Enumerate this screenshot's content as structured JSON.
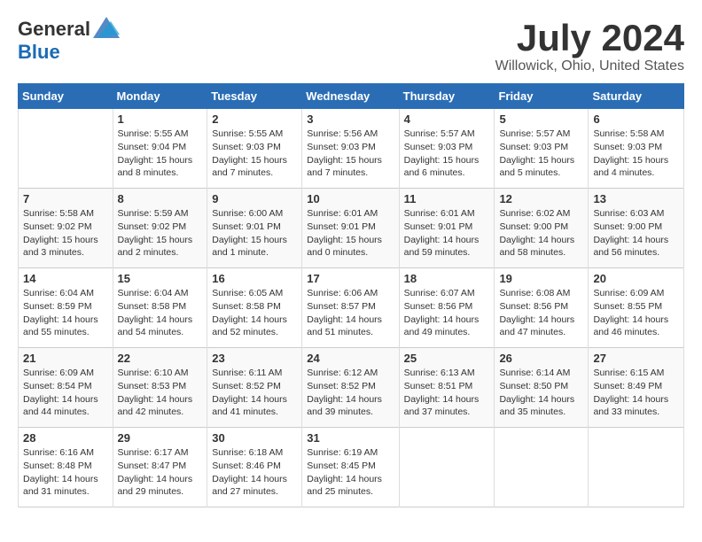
{
  "header": {
    "logo_general": "General",
    "logo_blue": "Blue",
    "month_title": "July 2024",
    "location": "Willowick, Ohio, United States"
  },
  "calendar": {
    "days_of_week": [
      "Sunday",
      "Monday",
      "Tuesday",
      "Wednesday",
      "Thursday",
      "Friday",
      "Saturday"
    ],
    "weeks": [
      [
        {
          "day": "",
          "sunrise": "",
          "sunset": "",
          "daylight": ""
        },
        {
          "day": "1",
          "sunrise": "Sunrise: 5:55 AM",
          "sunset": "Sunset: 9:04 PM",
          "daylight": "Daylight: 15 hours and 8 minutes."
        },
        {
          "day": "2",
          "sunrise": "Sunrise: 5:55 AM",
          "sunset": "Sunset: 9:03 PM",
          "daylight": "Daylight: 15 hours and 7 minutes."
        },
        {
          "day": "3",
          "sunrise": "Sunrise: 5:56 AM",
          "sunset": "Sunset: 9:03 PM",
          "daylight": "Daylight: 15 hours and 7 minutes."
        },
        {
          "day": "4",
          "sunrise": "Sunrise: 5:57 AM",
          "sunset": "Sunset: 9:03 PM",
          "daylight": "Daylight: 15 hours and 6 minutes."
        },
        {
          "day": "5",
          "sunrise": "Sunrise: 5:57 AM",
          "sunset": "Sunset: 9:03 PM",
          "daylight": "Daylight: 15 hours and 5 minutes."
        },
        {
          "day": "6",
          "sunrise": "Sunrise: 5:58 AM",
          "sunset": "Sunset: 9:03 PM",
          "daylight": "Daylight: 15 hours and 4 minutes."
        }
      ],
      [
        {
          "day": "7",
          "sunrise": "Sunrise: 5:58 AM",
          "sunset": "Sunset: 9:02 PM",
          "daylight": "Daylight: 15 hours and 3 minutes."
        },
        {
          "day": "8",
          "sunrise": "Sunrise: 5:59 AM",
          "sunset": "Sunset: 9:02 PM",
          "daylight": "Daylight: 15 hours and 2 minutes."
        },
        {
          "day": "9",
          "sunrise": "Sunrise: 6:00 AM",
          "sunset": "Sunset: 9:01 PM",
          "daylight": "Daylight: 15 hours and 1 minute."
        },
        {
          "day": "10",
          "sunrise": "Sunrise: 6:01 AM",
          "sunset": "Sunset: 9:01 PM",
          "daylight": "Daylight: 15 hours and 0 minutes."
        },
        {
          "day": "11",
          "sunrise": "Sunrise: 6:01 AM",
          "sunset": "Sunset: 9:01 PM",
          "daylight": "Daylight: 14 hours and 59 minutes."
        },
        {
          "day": "12",
          "sunrise": "Sunrise: 6:02 AM",
          "sunset": "Sunset: 9:00 PM",
          "daylight": "Daylight: 14 hours and 58 minutes."
        },
        {
          "day": "13",
          "sunrise": "Sunrise: 6:03 AM",
          "sunset": "Sunset: 9:00 PM",
          "daylight": "Daylight: 14 hours and 56 minutes."
        }
      ],
      [
        {
          "day": "14",
          "sunrise": "Sunrise: 6:04 AM",
          "sunset": "Sunset: 8:59 PM",
          "daylight": "Daylight: 14 hours and 55 minutes."
        },
        {
          "day": "15",
          "sunrise": "Sunrise: 6:04 AM",
          "sunset": "Sunset: 8:58 PM",
          "daylight": "Daylight: 14 hours and 54 minutes."
        },
        {
          "day": "16",
          "sunrise": "Sunrise: 6:05 AM",
          "sunset": "Sunset: 8:58 PM",
          "daylight": "Daylight: 14 hours and 52 minutes."
        },
        {
          "day": "17",
          "sunrise": "Sunrise: 6:06 AM",
          "sunset": "Sunset: 8:57 PM",
          "daylight": "Daylight: 14 hours and 51 minutes."
        },
        {
          "day": "18",
          "sunrise": "Sunrise: 6:07 AM",
          "sunset": "Sunset: 8:56 PM",
          "daylight": "Daylight: 14 hours and 49 minutes."
        },
        {
          "day": "19",
          "sunrise": "Sunrise: 6:08 AM",
          "sunset": "Sunset: 8:56 PM",
          "daylight": "Daylight: 14 hours and 47 minutes."
        },
        {
          "day": "20",
          "sunrise": "Sunrise: 6:09 AM",
          "sunset": "Sunset: 8:55 PM",
          "daylight": "Daylight: 14 hours and 46 minutes."
        }
      ],
      [
        {
          "day": "21",
          "sunrise": "Sunrise: 6:09 AM",
          "sunset": "Sunset: 8:54 PM",
          "daylight": "Daylight: 14 hours and 44 minutes."
        },
        {
          "day": "22",
          "sunrise": "Sunrise: 6:10 AM",
          "sunset": "Sunset: 8:53 PM",
          "daylight": "Daylight: 14 hours and 42 minutes."
        },
        {
          "day": "23",
          "sunrise": "Sunrise: 6:11 AM",
          "sunset": "Sunset: 8:52 PM",
          "daylight": "Daylight: 14 hours and 41 minutes."
        },
        {
          "day": "24",
          "sunrise": "Sunrise: 6:12 AM",
          "sunset": "Sunset: 8:52 PM",
          "daylight": "Daylight: 14 hours and 39 minutes."
        },
        {
          "day": "25",
          "sunrise": "Sunrise: 6:13 AM",
          "sunset": "Sunset: 8:51 PM",
          "daylight": "Daylight: 14 hours and 37 minutes."
        },
        {
          "day": "26",
          "sunrise": "Sunrise: 6:14 AM",
          "sunset": "Sunset: 8:50 PM",
          "daylight": "Daylight: 14 hours and 35 minutes."
        },
        {
          "day": "27",
          "sunrise": "Sunrise: 6:15 AM",
          "sunset": "Sunset: 8:49 PM",
          "daylight": "Daylight: 14 hours and 33 minutes."
        }
      ],
      [
        {
          "day": "28",
          "sunrise": "Sunrise: 6:16 AM",
          "sunset": "Sunset: 8:48 PM",
          "daylight": "Daylight: 14 hours and 31 minutes."
        },
        {
          "day": "29",
          "sunrise": "Sunrise: 6:17 AM",
          "sunset": "Sunset: 8:47 PM",
          "daylight": "Daylight: 14 hours and 29 minutes."
        },
        {
          "day": "30",
          "sunrise": "Sunrise: 6:18 AM",
          "sunset": "Sunset: 8:46 PM",
          "daylight": "Daylight: 14 hours and 27 minutes."
        },
        {
          "day": "31",
          "sunrise": "Sunrise: 6:19 AM",
          "sunset": "Sunset: 8:45 PM",
          "daylight": "Daylight: 14 hours and 25 minutes."
        },
        {
          "day": "",
          "sunrise": "",
          "sunset": "",
          "daylight": ""
        },
        {
          "day": "",
          "sunrise": "",
          "sunset": "",
          "daylight": ""
        },
        {
          "day": "",
          "sunrise": "",
          "sunset": "",
          "daylight": ""
        }
      ]
    ]
  }
}
